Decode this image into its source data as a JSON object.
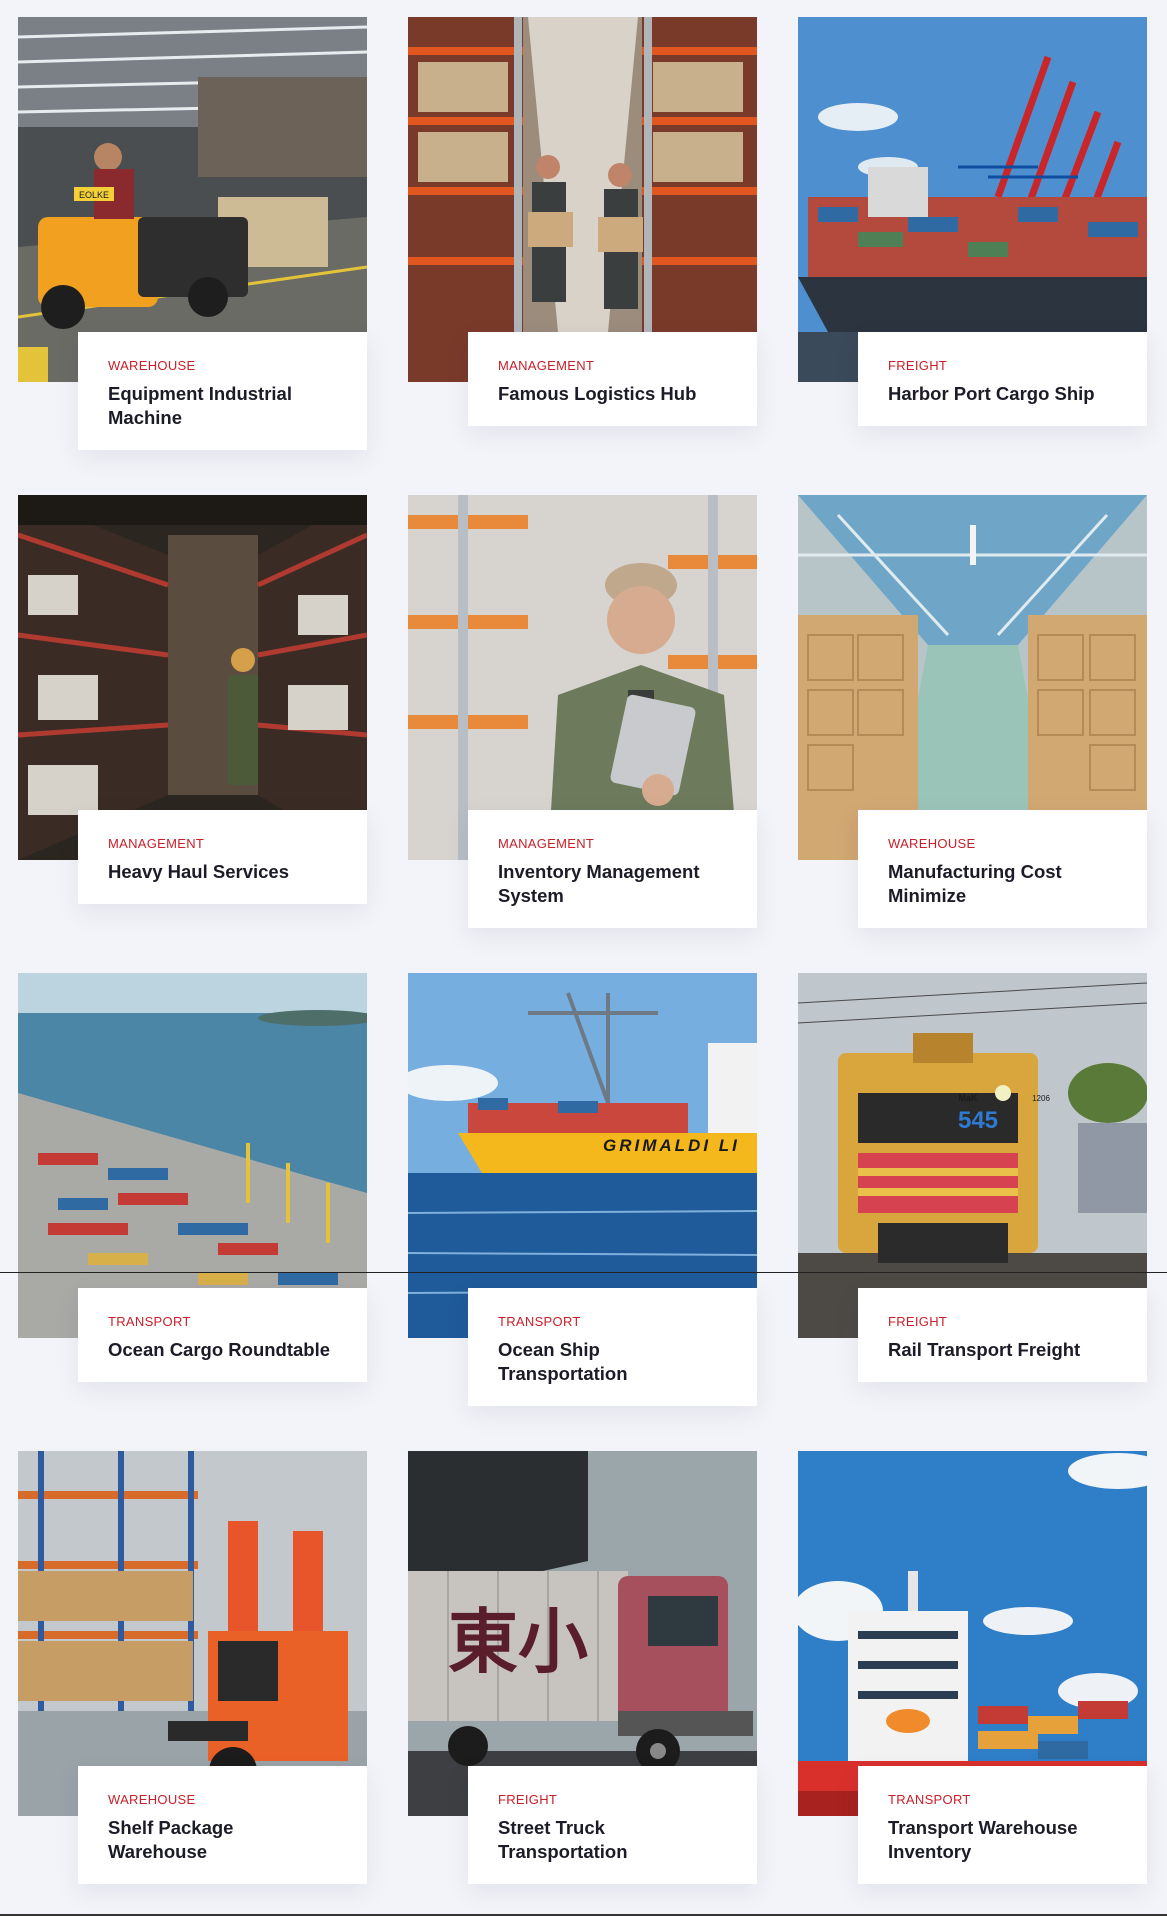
{
  "cards": [
    {
      "category": "WAREHOUSE",
      "title": "Equipment Industrial Machine",
      "image": "warehouse-tugger-driver-photo"
    },
    {
      "category": "MANAGEMENT",
      "title": "Famous Logistics Hub",
      "image": "workers-carrying-boxes-aisle-photo"
    },
    {
      "category": "FREIGHT",
      "title": "Harbor Port Cargo Ship",
      "image": "container-ship-cranes-photo"
    },
    {
      "category": "MANAGEMENT",
      "title": "Heavy Haul Services",
      "image": "worker-between-shelves-photo"
    },
    {
      "category": "MANAGEMENT",
      "title": "Inventory Management System",
      "image": "worker-with-tablet-photo"
    },
    {
      "category": "WAREHOUSE",
      "title": "Manufacturing Cost Minimize",
      "image": "carton-boxes-storage-photo"
    },
    {
      "category": "TRANSPORT",
      "title": "Ocean Cargo Roundtable",
      "image": "aerial-container-port-photo"
    },
    {
      "category": "TRANSPORT",
      "title": "Ocean Ship Transportation",
      "image": "grimaldi-ship-photo"
    },
    {
      "category": "FREIGHT",
      "title": "Rail Transport Freight",
      "image": "locomotive-545-photo"
    },
    {
      "category": "WAREHOUSE",
      "title": "Shelf Package Warehouse",
      "image": "forklift-warehouse-photo"
    },
    {
      "category": "FREIGHT",
      "title": "Street Truck Transportation",
      "image": "red-truck-photo"
    },
    {
      "category": "TRANSPORT",
      "title": "Transport Warehouse Inventory",
      "image": "cargo-ship-sky-photo"
    }
  ],
  "image_text": {
    "tug_label": "EOLKE",
    "ship_name": "GRIMALDI LI",
    "loco_number": "545",
    "loco_brand": "MaK",
    "loco_id": "1206",
    "truck_glyphs": "東小"
  },
  "colors": {
    "accent": "#c8202a",
    "title": "#1c1c28",
    "background": "#f3f4f9",
    "card": "#ffffff"
  }
}
